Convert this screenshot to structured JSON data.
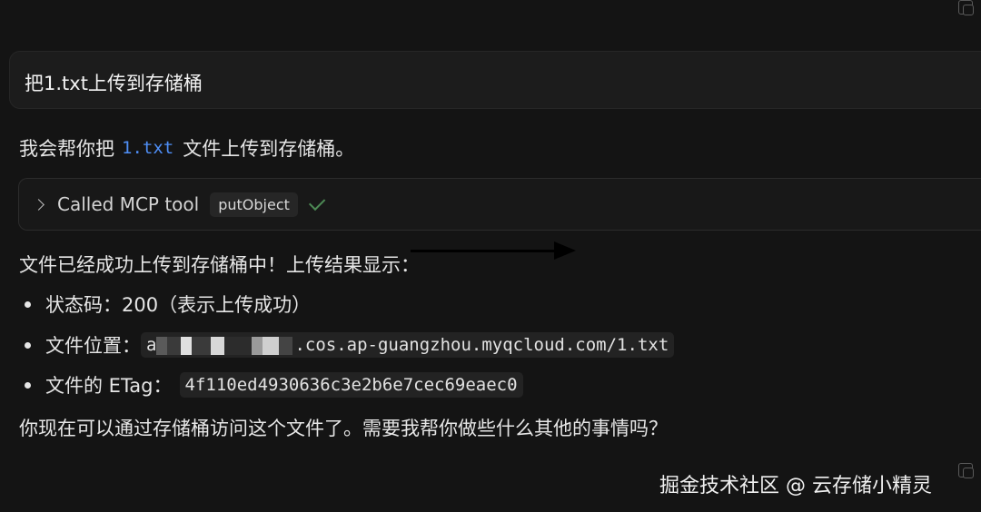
{
  "user_message": {
    "text": "把1.txt上传到存储桶"
  },
  "assistant": {
    "intro_prefix": "我会帮你把",
    "intro_code": "1.txt",
    "intro_suffix": "文件上传到存储桶。",
    "tool_call": {
      "label": "Called MCP tool",
      "tool_name": "putObject",
      "status": "success"
    },
    "result_heading": "文件已经成功上传到存储桶中！上传结果显示：",
    "bullets": [
      {
        "label": "状态码：",
        "value": "200（表示上传成功）"
      },
      {
        "label": "文件位置：",
        "value_prefix": "a",
        "value": ".cos.ap-guangzhou.myqcloud.com/1.txt"
      },
      {
        "label": "文件的 ETag：",
        "value": "4f110ed4930636c3e2b6e7cec69eaec0"
      }
    ],
    "closing": "你现在可以通过存储桶访问这个文件了。需要我帮你做些什么其他的事情吗？"
  },
  "watermark": "掘金技术社区 @ 云存储小精灵",
  "icons": {
    "copy": "copy-icon",
    "chevron": "chevron-right-icon",
    "check": "check-icon",
    "arrow": "arrow-right-icon"
  },
  "colors": {
    "background": "#141414",
    "code_accent": "#4f8ff7",
    "success": "#4d8a55"
  }
}
